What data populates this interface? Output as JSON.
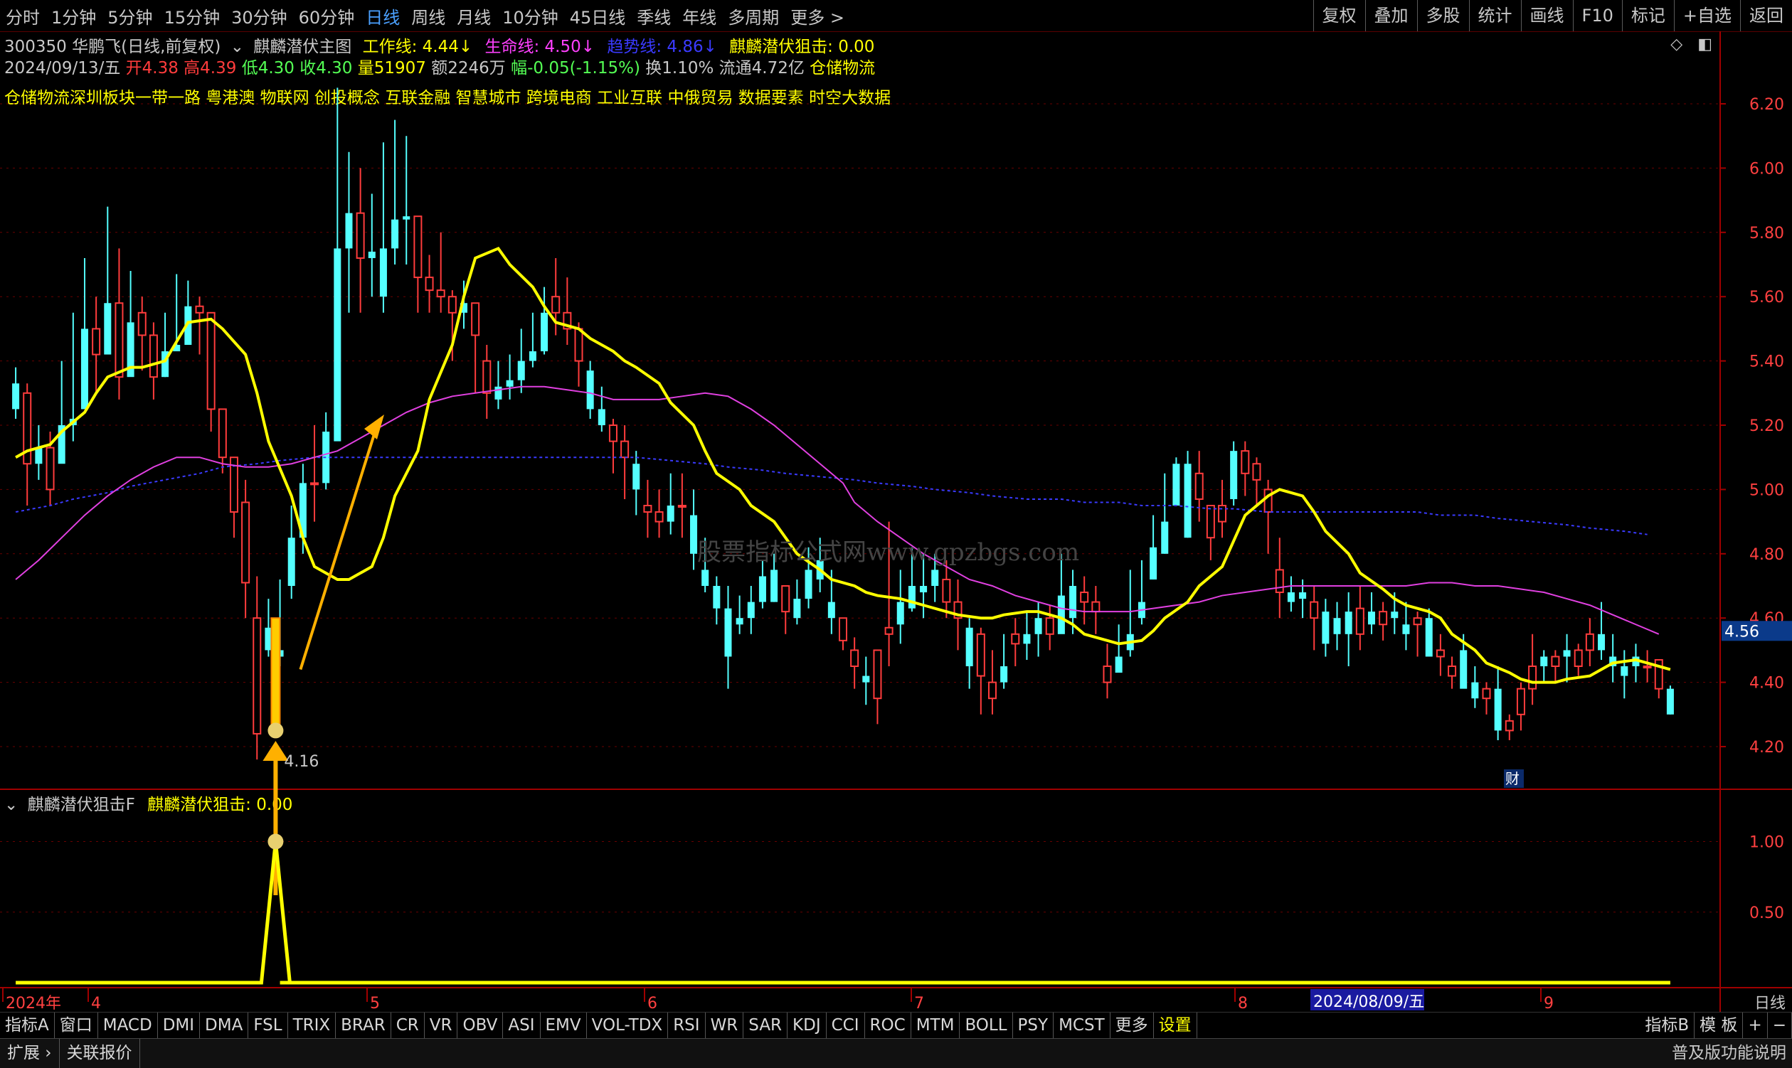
{
  "toolbar": {
    "periods": [
      "分时",
      "1分钟",
      "5分钟",
      "15分钟",
      "30分钟",
      "60分钟",
      "日线",
      "周线",
      "月线",
      "10分钟",
      "45日线",
      "季线",
      "年线",
      "多周期",
      "更多 >"
    ],
    "active_period": "日线",
    "tools": [
      "复权",
      "叠加",
      "多股",
      "统计",
      "画线",
      "F10",
      "标记",
      "+自选",
      "返回"
    ]
  },
  "stock": {
    "code_name": "300350 华鹏飞(日线,前复权)",
    "indicator_name": "麒麟潜伏主图",
    "work_line": "工作线: 4.44↓",
    "life_line": "生命线: 4.50↓",
    "trend_line": "趋势线: 4.86↓",
    "snipe": "麒麟潜伏狙击: 0.00",
    "quote": {
      "date": "2024/09/13/五",
      "open": "开4.38",
      "high": "高4.39",
      "low": "低4.30",
      "close": "收4.30",
      "volume": "量51907",
      "amount": "额2246万",
      "change": "幅-0.05(-1.15%)",
      "turnover": "换1.10%",
      "float_cap": "流通4.72亿",
      "industry": "仓储物流"
    },
    "concepts": "仓储物流深圳板块一带一路 粤港澳 物联网 创投概念 互联金融 智慧城市 跨境电商 工业互联 中俄贸易 数据要素 时空大数据"
  },
  "sub_panel": {
    "name": "麒麟潜伏狙击F",
    "value": "麒麟潜伏狙击: 0.00"
  },
  "watermark": "股票指标公式网www.gpzbgs.com",
  "annotations": {
    "low_label": "4.16",
    "current_price": "4.56",
    "finance_mark": "财",
    "cursor_date": "2024/08/09/五",
    "period_label": "日线"
  },
  "colors": {
    "up": "#ff3c3c",
    "down": "#54ffff",
    "work_line": "#ffff00",
    "life_line": "#e040e0",
    "trend_line": "#3a3aff",
    "arrow": "#ffb000",
    "axis": "#a00000"
  },
  "chart_data": {
    "type": "candlestick",
    "y_ticks_main": [
      "6.20",
      "6.00",
      "5.80",
      "5.60",
      "5.40",
      "5.20",
      "5.00",
      "4.80",
      "4.60",
      "4.40",
      "4.20"
    ],
    "y_ticks_sub": [
      "1.00",
      "0.50"
    ],
    "x_ticks": [
      "2024年",
      "4",
      "5",
      "6",
      "7",
      "8",
      "9"
    ],
    "ohlc": [
      [
        5.33,
        5.38,
        5.22,
        5.25
      ],
      [
        5.08,
        5.33,
        4.95,
        5.3
      ],
      [
        5.13,
        5.2,
        5.03,
        5.08
      ],
      [
        5.0,
        5.18,
        4.95,
        5.13
      ],
      [
        5.2,
        5.4,
        5.17,
        5.08
      ],
      [
        5.22,
        5.55,
        5.15,
        5.2
      ],
      [
        5.5,
        5.72,
        5.42,
        5.25
      ],
      [
        5.42,
        5.6,
        5.3,
        5.5
      ],
      [
        5.58,
        5.88,
        5.48,
        5.42
      ],
      [
        5.35,
        5.75,
        5.28,
        5.58
      ],
      [
        5.52,
        5.68,
        5.38,
        5.35
      ],
      [
        5.48,
        5.6,
        5.37,
        5.55
      ],
      [
        5.35,
        5.52,
        5.28,
        5.48
      ],
      [
        5.43,
        5.55,
        5.35,
        5.35
      ],
      [
        5.45,
        5.67,
        5.43,
        5.43
      ],
      [
        5.57,
        5.65,
        5.48,
        5.45
      ],
      [
        5.55,
        5.6,
        5.42,
        5.57
      ],
      [
        5.25,
        5.42,
        5.18,
        5.55
      ],
      [
        5.1,
        5.25,
        5.05,
        5.25
      ],
      [
        4.93,
        5.1,
        4.85,
        5.1
      ],
      [
        4.71,
        5.03,
        4.6,
        4.96
      ],
      [
        4.24,
        4.73,
        4.16,
        4.6
      ],
      [
        4.57,
        4.66,
        4.48,
        4.5
      ],
      [
        4.5,
        4.72,
        4.45,
        4.48
      ],
      [
        4.85,
        4.95,
        4.66,
        4.7
      ],
      [
        5.02,
        5.08,
        4.8,
        4.85
      ],
      [
        5.02,
        5.2,
        4.9,
        5.02
      ],
      [
        5.18,
        5.24,
        5.0,
        5.02
      ],
      [
        5.75,
        6.25,
        5.6,
        5.15
      ],
      [
        5.86,
        6.05,
        5.55,
        5.75
      ],
      [
        5.72,
        6.0,
        5.55,
        5.86
      ],
      [
        5.74,
        5.92,
        5.6,
        5.72
      ],
      [
        5.75,
        6.08,
        5.55,
        5.6
      ],
      [
        5.84,
        6.15,
        5.7,
        5.75
      ],
      [
        5.85,
        6.1,
        5.7,
        5.84
      ],
      [
        5.66,
        5.78,
        5.55,
        5.85
      ],
      [
        5.62,
        5.73,
        5.55,
        5.66
      ],
      [
        5.6,
        5.8,
        5.55,
        5.62
      ],
      [
        5.55,
        5.62,
        5.4,
        5.6
      ],
      [
        5.58,
        5.65,
        5.5,
        5.55
      ],
      [
        5.48,
        5.55,
        5.3,
        5.58
      ],
      [
        5.3,
        5.45,
        5.22,
        5.4
      ],
      [
        5.32,
        5.4,
        5.25,
        5.28
      ],
      [
        5.34,
        5.42,
        5.28,
        5.32
      ],
      [
        5.4,
        5.5,
        5.3,
        5.34
      ],
      [
        5.43,
        5.55,
        5.38,
        5.4
      ],
      [
        5.55,
        5.63,
        5.42,
        5.43
      ],
      [
        5.55,
        5.72,
        5.48,
        5.6
      ],
      [
        5.5,
        5.66,
        5.45,
        5.55
      ],
      [
        5.4,
        5.52,
        5.32,
        5.5
      ],
      [
        5.37,
        5.4,
        5.22,
        5.25
      ],
      [
        5.25,
        5.32,
        5.18,
        5.2
      ],
      [
        5.15,
        5.22,
        5.05,
        5.2
      ],
      [
        5.1,
        5.2,
        4.97,
        5.15
      ],
      [
        5.08,
        5.12,
        4.92,
        5.0
      ],
      [
        4.93,
        5.03,
        4.85,
        4.95
      ],
      [
        4.9,
        5.0,
        4.85,
        4.93
      ],
      [
        4.95,
        5.05,
        4.86,
        4.9
      ],
      [
        4.95,
        5.05,
        4.85,
        4.95
      ],
      [
        4.92,
        5.0,
        4.75,
        4.8
      ],
      [
        4.75,
        4.85,
        4.68,
        4.7
      ],
      [
        4.7,
        4.73,
        4.58,
        4.63
      ],
      [
        4.63,
        4.7,
        4.38,
        4.48
      ],
      [
        4.6,
        4.67,
        4.55,
        4.58
      ],
      [
        4.65,
        4.7,
        4.55,
        4.6
      ],
      [
        4.73,
        4.78,
        4.63,
        4.65
      ],
      [
        4.75,
        4.8,
        4.65,
        4.65
      ],
      [
        4.62,
        4.7,
        4.55,
        4.7
      ],
      [
        4.66,
        4.72,
        4.58,
        4.6
      ],
      [
        4.75,
        4.82,
        4.63,
        4.66
      ],
      [
        4.78,
        4.85,
        4.68,
        4.72
      ],
      [
        4.65,
        4.75,
        4.55,
        4.6
      ],
      [
        4.53,
        4.6,
        4.5,
        4.6
      ],
      [
        4.45,
        4.54,
        4.38,
        4.5
      ],
      [
        4.42,
        4.48,
        4.33,
        4.4
      ],
      [
        4.35,
        4.5,
        4.27,
        4.5
      ],
      [
        4.55,
        4.9,
        4.45,
        4.57
      ],
      [
        4.65,
        4.75,
        4.52,
        4.58
      ],
      [
        4.7,
        4.82,
        4.62,
        4.63
      ],
      [
        4.7,
        4.8,
        4.6,
        4.68
      ],
      [
        4.75,
        4.8,
        4.65,
        4.7
      ],
      [
        4.65,
        4.78,
        4.6,
        4.72
      ],
      [
        4.6,
        4.72,
        4.5,
        4.65
      ],
      [
        4.57,
        4.6,
        4.38,
        4.45
      ],
      [
        4.42,
        4.57,
        4.3,
        4.55
      ],
      [
        4.35,
        4.5,
        4.3,
        4.4
      ],
      [
        4.45,
        4.55,
        4.38,
        4.4
      ],
      [
        4.52,
        4.6,
        4.45,
        4.55
      ],
      [
        4.55,
        4.62,
        4.47,
        4.52
      ],
      [
        4.6,
        4.65,
        4.48,
        4.55
      ],
      [
        4.55,
        4.64,
        4.5,
        4.6
      ],
      [
        4.67,
        4.8,
        4.6,
        4.55
      ],
      [
        4.7,
        4.75,
        4.55,
        4.6
      ],
      [
        4.65,
        4.73,
        4.58,
        4.68
      ],
      [
        4.62,
        4.7,
        4.55,
        4.65
      ],
      [
        4.4,
        4.52,
        4.35,
        4.45
      ],
      [
        4.48,
        4.58,
        4.43,
        4.43
      ],
      [
        4.55,
        4.75,
        4.48,
        4.5
      ],
      [
        4.65,
        4.78,
        4.58,
        4.6
      ],
      [
        4.82,
        4.92,
        4.72,
        4.72
      ],
      [
        4.9,
        5.05,
        4.8,
        4.8
      ],
      [
        5.08,
        5.1,
        4.95,
        4.95
      ],
      [
        5.08,
        5.12,
        4.85,
        4.85
      ],
      [
        4.97,
        5.12,
        4.9,
        5.05
      ],
      [
        4.85,
        4.95,
        4.78,
        4.95
      ],
      [
        4.9,
        5.03,
        4.85,
        4.95
      ],
      [
        5.12,
        5.15,
        4.95,
        4.97
      ],
      [
        5.05,
        5.15,
        4.98,
        5.12
      ],
      [
        5.03,
        5.1,
        4.95,
        5.08
      ],
      [
        4.93,
        5.03,
        4.8,
        5.0
      ],
      [
        4.68,
        4.85,
        4.6,
        4.75
      ],
      [
        4.68,
        4.73,
        4.62,
        4.65
      ],
      [
        4.68,
        4.72,
        4.6,
        4.66
      ],
      [
        4.6,
        4.7,
        4.5,
        4.65
      ],
      [
        4.62,
        4.66,
        4.48,
        4.52
      ],
      [
        4.6,
        4.65,
        4.5,
        4.55
      ],
      [
        4.62,
        4.68,
        4.45,
        4.55
      ],
      [
        4.55,
        4.7,
        4.5,
        4.63
      ],
      [
        4.62,
        4.68,
        4.55,
        4.58
      ],
      [
        4.58,
        4.65,
        4.53,
        4.62
      ],
      [
        4.62,
        4.68,
        4.55,
        4.6
      ],
      [
        4.58,
        4.65,
        4.5,
        4.55
      ],
      [
        4.58,
        4.62,
        4.48,
        4.6
      ],
      [
        4.6,
        4.63,
        4.5,
        4.48
      ],
      [
        4.48,
        4.55,
        4.42,
        4.5
      ],
      [
        4.42,
        4.48,
        4.38,
        4.45
      ],
      [
        4.5,
        4.55,
        4.4,
        4.38
      ],
      [
        4.4,
        4.45,
        4.32,
        4.35
      ],
      [
        4.35,
        4.4,
        4.3,
        4.38
      ],
      [
        4.38,
        4.45,
        4.22,
        4.25
      ],
      [
        4.25,
        4.3,
        4.22,
        4.28
      ],
      [
        4.3,
        4.4,
        4.25,
        4.38
      ],
      [
        4.38,
        4.55,
        4.33,
        4.45
      ],
      [
        4.48,
        4.5,
        4.4,
        4.45
      ],
      [
        4.45,
        4.5,
        4.4,
        4.48
      ],
      [
        4.5,
        4.55,
        4.4,
        4.48
      ],
      [
        4.45,
        4.52,
        4.42,
        4.5
      ],
      [
        4.5,
        4.6,
        4.45,
        4.55
      ],
      [
        4.55,
        4.65,
        4.47,
        4.5
      ],
      [
        4.48,
        4.55,
        4.4,
        4.45
      ],
      [
        4.45,
        4.5,
        4.35,
        4.42
      ],
      [
        4.48,
        4.52,
        4.4,
        4.45
      ],
      [
        4.45,
        4.5,
        4.4,
        4.45
      ],
      [
        4.38,
        4.47,
        4.35,
        4.47
      ],
      [
        4.38,
        4.39,
        4.3,
        4.3
      ]
    ],
    "work_line": [
      5.1,
      5.12,
      5.14,
      5.18,
      5.24,
      5.3,
      5.35,
      5.38,
      5.38,
      5.4,
      5.46,
      5.52,
      5.53,
      5.5,
      5.42,
      5.3,
      5.15,
      4.98,
      4.85,
      4.76,
      4.72,
      4.72,
      4.76,
      4.85,
      4.98,
      5.12,
      5.28,
      5.45,
      5.6,
      5.72,
      5.75,
      5.7,
      5.63,
      5.57,
      5.52,
      5.5,
      5.47,
      5.43,
      5.4,
      5.38,
      5.33,
      5.27,
      5.2,
      5.12,
      5.05,
      5.0,
      4.95,
      4.9,
      4.85,
      4.8,
      4.75,
      4.72,
      4.7,
      4.68,
      4.67,
      4.66,
      4.65,
      4.64,
      4.62,
      4.61,
      4.6,
      4.6,
      4.61,
      4.62,
      4.62,
      4.6,
      4.58,
      4.55,
      4.53,
      4.52,
      4.53,
      4.56,
      4.6,
      4.65,
      4.7,
      4.76,
      4.84,
      4.92,
      4.98,
      5.0,
      4.98,
      4.93,
      4.87,
      4.8,
      4.74,
      4.69,
      4.66,
      4.64,
      4.62,
      4.6,
      4.55,
      4.5,
      4.46,
      4.43,
      4.41,
      4.4,
      4.4,
      4.41,
      4.42,
      4.44,
      4.46,
      4.47,
      4.46,
      4.44
    ],
    "life_line": [
      4.72,
      4.78,
      4.85,
      4.92,
      4.98,
      5.03,
      5.07,
      5.1,
      5.1,
      5.08,
      5.07,
      5.07,
      5.08,
      5.1,
      5.12,
      5.16,
      5.2,
      5.24,
      5.27,
      5.29,
      5.3,
      5.31,
      5.32,
      5.32,
      5.31,
      5.3,
      5.28,
      5.28,
      5.28,
      5.29,
      5.3,
      5.29,
      5.25,
      5.2,
      5.14,
      5.08,
      5.02,
      4.96,
      4.9,
      4.85,
      4.8,
      4.76,
      4.72,
      4.7,
      4.67,
      4.65,
      4.63,
      4.62,
      4.62,
      4.62,
      4.63,
      4.64,
      4.65,
      4.67,
      4.68,
      4.69,
      4.7,
      4.7,
      4.7,
      4.7,
      4.7,
      4.7,
      4.71,
      4.71,
      4.7,
      4.7,
      4.69,
      4.68,
      4.66,
      4.64,
      4.61,
      4.58,
      4.55
    ],
    "trend_line": [
      4.93,
      4.95,
      4.97,
      4.99,
      5.01,
      5.03,
      5.05,
      5.07,
      5.08,
      5.09,
      5.1,
      5.1,
      5.1,
      5.1,
      5.1,
      5.1,
      5.1,
      5.1,
      5.1,
      5.1,
      5.1,
      5.1,
      5.09,
      5.08,
      5.07,
      5.06,
      5.05,
      5.04,
      5.03,
      5.02,
      5.01,
      5.0,
      4.99,
      4.98,
      4.97,
      4.97,
      4.96,
      4.96,
      4.95,
      4.95,
      4.94,
      4.94,
      4.93,
      4.93,
      4.93,
      4.93,
      4.93,
      4.93,
      4.92,
      4.92,
      4.91,
      4.9,
      4.89,
      4.88,
      4.87,
      4.86
    ],
    "signal_bar_index": 22,
    "sub_signal": [
      0,
      0,
      0,
      0,
      0,
      0,
      0,
      0,
      0,
      0,
      0,
      0,
      0,
      0,
      0,
      0,
      0,
      0,
      0,
      0,
      0,
      0,
      1,
      0,
      0,
      0,
      0,
      0,
      0,
      0,
      0,
      0,
      0,
      0,
      0,
      0,
      0,
      0,
      0,
      0,
      0,
      0,
      0,
      0,
      0,
      0,
      0,
      0,
      0,
      0,
      0,
      0,
      0,
      0,
      0,
      0,
      0,
      0,
      0,
      0,
      0,
      0,
      0,
      0,
      0,
      0,
      0,
      0,
      0,
      0,
      0,
      0,
      0,
      0,
      0,
      0,
      0,
      0,
      0,
      0,
      0,
      0,
      0,
      0,
      0,
      0,
      0,
      0,
      0,
      0,
      0,
      0,
      0,
      0,
      0,
      0,
      0,
      0,
      0,
      0,
      0,
      0,
      0,
      0,
      0,
      0,
      0,
      0,
      0,
      0,
      0,
      0,
      0,
      0,
      0,
      0,
      0,
      0,
      0,
      0,
      0,
      0,
      0,
      0,
      0,
      0,
      0,
      0,
      0,
      0,
      0,
      0,
      0,
      0,
      0,
      0,
      0,
      0,
      0,
      0,
      0,
      0,
      0,
      0,
      0,
      0,
      0,
      0,
      0,
      0,
      0,
      0
    ],
    "sub_ylim": [
      0,
      1.3
    ],
    "main_ylim": [
      4.1,
      6.3
    ]
  }
}
